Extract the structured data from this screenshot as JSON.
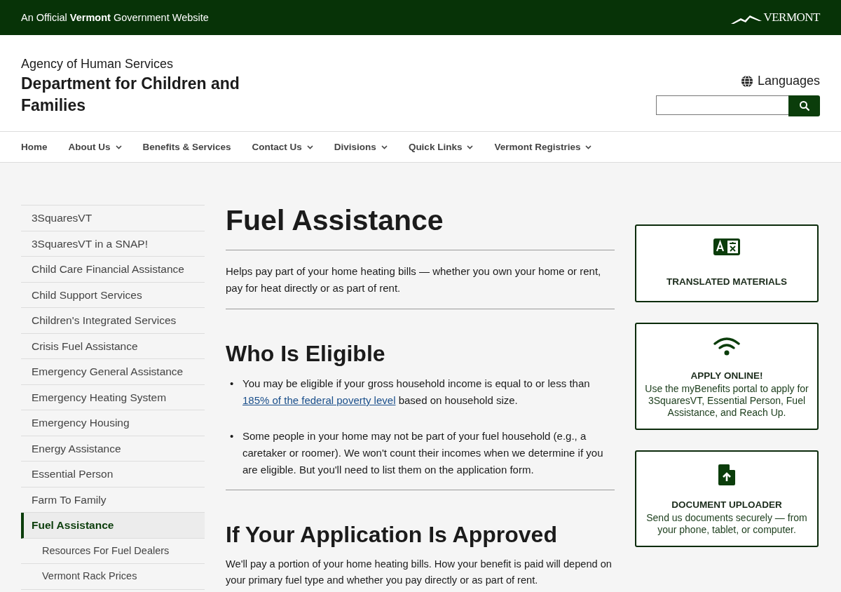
{
  "official_banner": {
    "text": "An Official **Vermont** Government Website",
    "logo_text": "VERMONT"
  },
  "header": {
    "agency": "Agency of Human Services",
    "department": "Department for Children and Families",
    "languages": "Languages"
  },
  "nav": [
    {
      "label": "Home",
      "has_dropdown": false
    },
    {
      "label": "About Us",
      "has_dropdown": true
    },
    {
      "label": "Benefits & Services",
      "has_dropdown": false
    },
    {
      "label": "Contact Us",
      "has_dropdown": true
    },
    {
      "label": "Divisions",
      "has_dropdown": true
    },
    {
      "label": "Quick Links",
      "has_dropdown": true
    },
    {
      "label": "Vermont Registries",
      "has_dropdown": true
    }
  ],
  "sidebar": {
    "items": [
      {
        "label": "3SquaresVT",
        "selected": false
      },
      {
        "label": "3SquaresVT in a SNAP!",
        "selected": false
      },
      {
        "label": "Child Care Financial Assistance",
        "selected": false
      },
      {
        "label": "Child Support Services",
        "selected": false
      },
      {
        "label": "Children's Integrated Services",
        "selected": false
      },
      {
        "label": "Crisis Fuel Assistance",
        "selected": false
      },
      {
        "label": "Emergency General Assistance",
        "selected": false
      },
      {
        "label": "Emergency Heating System",
        "selected": false
      },
      {
        "label": "Emergency Housing",
        "selected": false
      },
      {
        "label": "Energy Assistance",
        "selected": false
      },
      {
        "label": "Essential Person",
        "selected": false
      },
      {
        "label": "Farm To Family",
        "selected": false
      },
      {
        "label": "Fuel Assistance",
        "selected": true,
        "children": [
          {
            "label": "Resources For Fuel Dealers",
            "selected": false
          },
          {
            "label": "Vermont Rack Prices",
            "selected": false
          }
        ]
      }
    ]
  },
  "main": {
    "title": "Fuel Assistance",
    "intro": "Helps pay part of your home heating bills — whether you own your home or rent, pay for heat directly or as part of rent.",
    "sections": [
      {
        "heading": "Who Is Eligible",
        "bullets": [
          {
            "marker": "•",
            "before": "You may be eligible if your gross household income is equal to or less than ",
            "link": "185% of the federal poverty level",
            "after": " based on household size."
          },
          {
            "marker": "•",
            "before": "Some people in your home may not be part of your fuel household (e.g., a caretaker or roomer). We won't count their incomes when we determine if you are eligible. But you'll need to list them on the application form."
          }
        ]
      },
      {
        "heading": "If Your Application Is Approved",
        "paragraph": "We'll pay a portion of your home heating bills. How your benefit is paid will depend on your primary fuel type and whether you pay directly or as part of rent."
      }
    ]
  },
  "cards": [
    {
      "kind": "translate",
      "title": "TRANSLATED MATERIALS"
    },
    {
      "kind": "wifi",
      "title": "APPLY ONLINE!",
      "text": "Use the myBenefits portal to apply for 3SquaresVT, Essential Person, Fuel Assistance, and Reach Up."
    },
    {
      "kind": "upload",
      "title": "DOCUMENT UPLOADER",
      "text": "Send us documents securely — from your phone, tablet, or computer."
    }
  ]
}
